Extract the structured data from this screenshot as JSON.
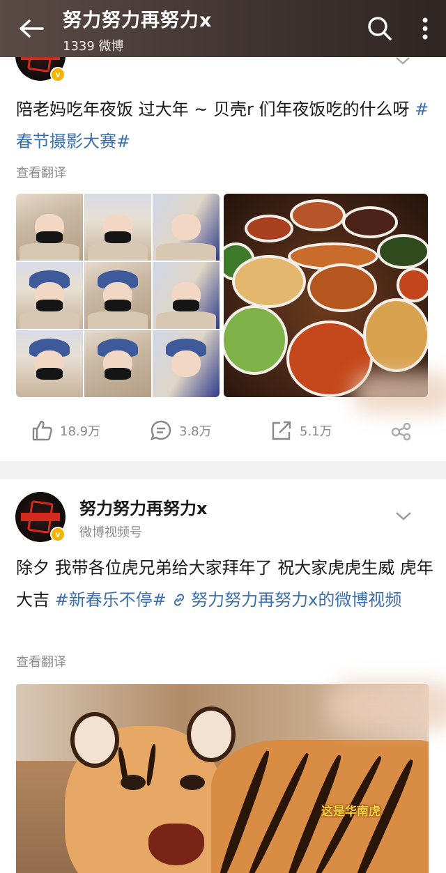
{
  "header": {
    "title": "努力努力再努力x",
    "subtitle": "1339 微博"
  },
  "post1": {
    "text": "陪老妈吃年夜饭 过大年 ~ 贝壳r 们年夜饭吃的什么呀 ",
    "tag": "#春节摄影大赛#",
    "translate": "查看翻译",
    "likes": "18.9万",
    "comments": "3.8万",
    "reposts": "5.1万"
  },
  "post2": {
    "author": "努力努力再努力x",
    "source": "微博视频号",
    "text": "除夕 我带各位虎兄弟给大家拜年了 祝大家虎虎生威 虎年大吉 ",
    "tag": "#新春乐不停#",
    "link": " 努力努力再努力x的微博视频",
    "translate": "查看翻译",
    "video_caption": "这是华南虎"
  },
  "colors": {
    "header_bg": "#453835",
    "tag_blue": "#3a6fb0",
    "verified_badge": "#f5b400"
  }
}
